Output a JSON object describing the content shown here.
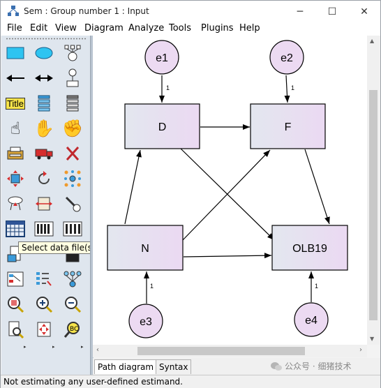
{
  "window": {
    "title": "Sem : Group number 1 : Input",
    "buttons": {
      "minimize": "─",
      "maximize": "☐",
      "close": "✕"
    }
  },
  "menu": [
    "File",
    "Edit",
    "View",
    "Diagram",
    "Analyze",
    "Tools",
    "Plugins",
    "Help"
  ],
  "toolbox": {
    "title_button": "Title",
    "tooltip": "Select data file(s)"
  },
  "diagram": {
    "observed": [
      "D",
      "F",
      "N",
      "OLB19"
    ],
    "errors": [
      "e1",
      "e2",
      "e3",
      "e4"
    ],
    "path_labels": [
      "1",
      "1",
      "1",
      "1"
    ]
  },
  "tabs": {
    "path": "Path diagram",
    "syntax": "Syntax"
  },
  "watermark": "公众号 · 细猪技术",
  "status": "Not estimating any user-defined estimand.",
  "colors": {
    "box_left": "#e3e7ef",
    "box_right": "#ebd9f2",
    "circle": "#ecdaf2",
    "toolbox_bg": "#dfe6ee"
  }
}
